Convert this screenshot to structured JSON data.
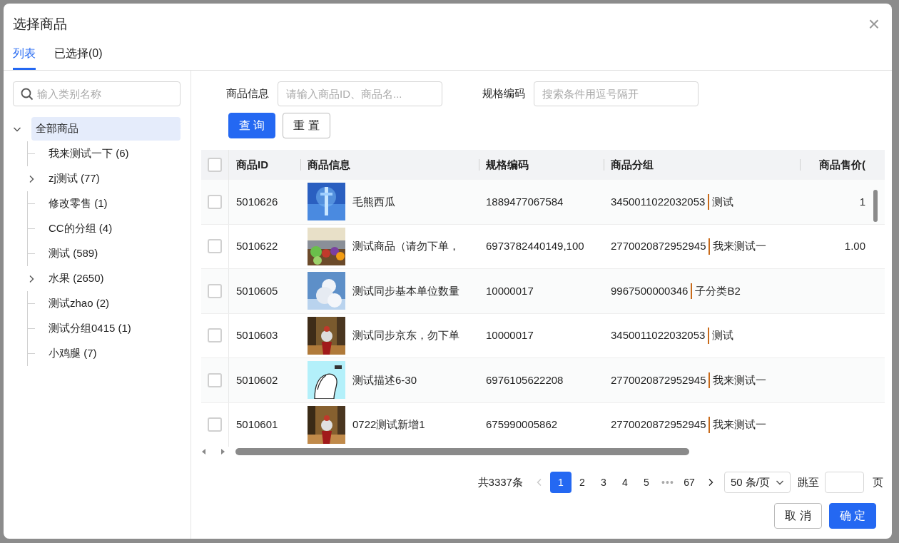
{
  "dialog": {
    "title": "选择商品",
    "close": "×"
  },
  "tabs": [
    {
      "label": "列表",
      "selected": true
    },
    {
      "label": "已选择(0)",
      "selected": false
    }
  ],
  "category_search": {
    "placeholder": "输入类别名称"
  },
  "tree": {
    "label": "全部商品",
    "expanded": true,
    "selected": true,
    "children": [
      {
        "label": "我来测试一下 (6)",
        "kind": "leaf"
      },
      {
        "label": "zj测试 (77)",
        "kind": "branch",
        "expanded": false
      },
      {
        "label": "修改零售 (1)",
        "kind": "leaf"
      },
      {
        "label": "CC的分组 (4)",
        "kind": "leaf"
      },
      {
        "label": "测试 (589)",
        "kind": "leaf"
      },
      {
        "label": "水果 (2650)",
        "kind": "branch",
        "expanded": false
      },
      {
        "label": "测试zhao (2)",
        "kind": "leaf"
      },
      {
        "label": "测试分组0415 (1)",
        "kind": "leaf"
      },
      {
        "label": "小鸡腿 (7)",
        "kind": "leaf"
      }
    ]
  },
  "filters": [
    {
      "label": "商品信息",
      "placeholder": "请输入商品ID、商品名..."
    },
    {
      "label": "规格编码",
      "placeholder": "搜索条件用逗号隔开"
    }
  ],
  "filter_buttons": [
    {
      "label": "查 询",
      "kind": "primary"
    },
    {
      "label": "重 置",
      "kind": "default"
    }
  ],
  "table": {
    "select_all": {
      "checked": false
    },
    "columns": [
      "商品ID",
      "商品信息",
      "规格编码",
      "商品分组",
      "商品售价("
    ],
    "rows": [
      {
        "checked": false,
        "id": "5010626",
        "name": "毛熊西瓜",
        "spec": "1889477067584",
        "group_code": "3450011022032053",
        "group_name": "测试",
        "price": "1"
      },
      {
        "checked": false,
        "id": "5010622",
        "name": "测试商品（请勿下单，",
        "spec": "6973782440149,100",
        "group_code": "2770020872952945",
        "group_name": "我来测试一",
        "price": "1.00"
      },
      {
        "checked": false,
        "id": "5010605",
        "name": "测试同步基本单位数量",
        "spec": "10000017",
        "group_code": "9967500000346",
        "group_name": "子分类B2"
      },
      {
        "checked": false,
        "id": "5010603",
        "name": "测试同步京东，勿下单",
        "spec": "10000017",
        "group_code": "3450011022032053",
        "group_name": "测试"
      },
      {
        "checked": false,
        "id": "5010602",
        "name": "测试描述6-30",
        "spec": "6976105622208",
        "group_code": "2770020872952945",
        "group_name": "我来测试一"
      },
      {
        "checked": false,
        "id": "5010601",
        "name": "0722测试新增1",
        "spec": "675990005862",
        "group_code": "2770020872952945",
        "group_name": "我来测试一"
      }
    ]
  },
  "pagination": {
    "total": "共3337条",
    "prev": {
      "disabled": true
    },
    "pages": [
      {
        "label": "1",
        "selected": true
      },
      {
        "label": "2",
        "selected": false
      },
      {
        "label": "3",
        "selected": false
      },
      {
        "label": "4",
        "selected": false
      },
      {
        "label": "5",
        "selected": false
      },
      {
        "label": "•••",
        "selected": false,
        "kind": "ellipsis"
      },
      {
        "label": "67",
        "selected": false
      }
    ],
    "next": {
      "disabled": false
    },
    "page_size": "50 条/页",
    "jump_label": "跳至",
    "jump_suffix": "页"
  },
  "footer_buttons": [
    {
      "label": "取 消",
      "kind": "default"
    },
    {
      "label": "确 定",
      "kind": "primary"
    }
  ]
}
